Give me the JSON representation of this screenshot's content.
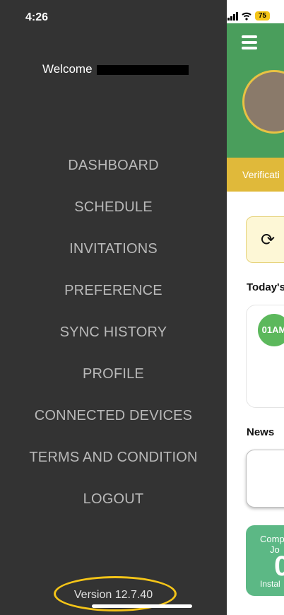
{
  "status_bar": {
    "time": "4:26",
    "battery": "75"
  },
  "drawer": {
    "welcome_label": "Welcome",
    "menu": [
      {
        "label": "DASHBOARD"
      },
      {
        "label": "SCHEDULE"
      },
      {
        "label": "INVITATIONS"
      },
      {
        "label": "PREFERENCE"
      },
      {
        "label": "SYNC HISTORY"
      },
      {
        "label": "PROFILE"
      },
      {
        "label": "CONNECTED DEVICES"
      },
      {
        "label": "TERMS AND CONDITION"
      },
      {
        "label": "LOGOUT"
      }
    ],
    "version": "Version 12.7.40"
  },
  "background_screen": {
    "verification_text": "Verificati",
    "today_label": "Today's",
    "schedule_time": "01AM",
    "news_label": "News",
    "stat_label_top": "Comp",
    "stat_label_mid": "Jo",
    "stat_value": "0",
    "stat_label_bottom": "Instal"
  },
  "colors": {
    "drawer_bg": "#333333",
    "menu_text": "#b9b9b9",
    "header_green": "#4a9e5c",
    "verify_yellow": "#e0b93a",
    "highlight_oval": "#f5c518"
  },
  "icons": [
    "hamburger-menu-icon",
    "sync-icon",
    "signal-icon",
    "wifi-icon",
    "battery-icon"
  ]
}
